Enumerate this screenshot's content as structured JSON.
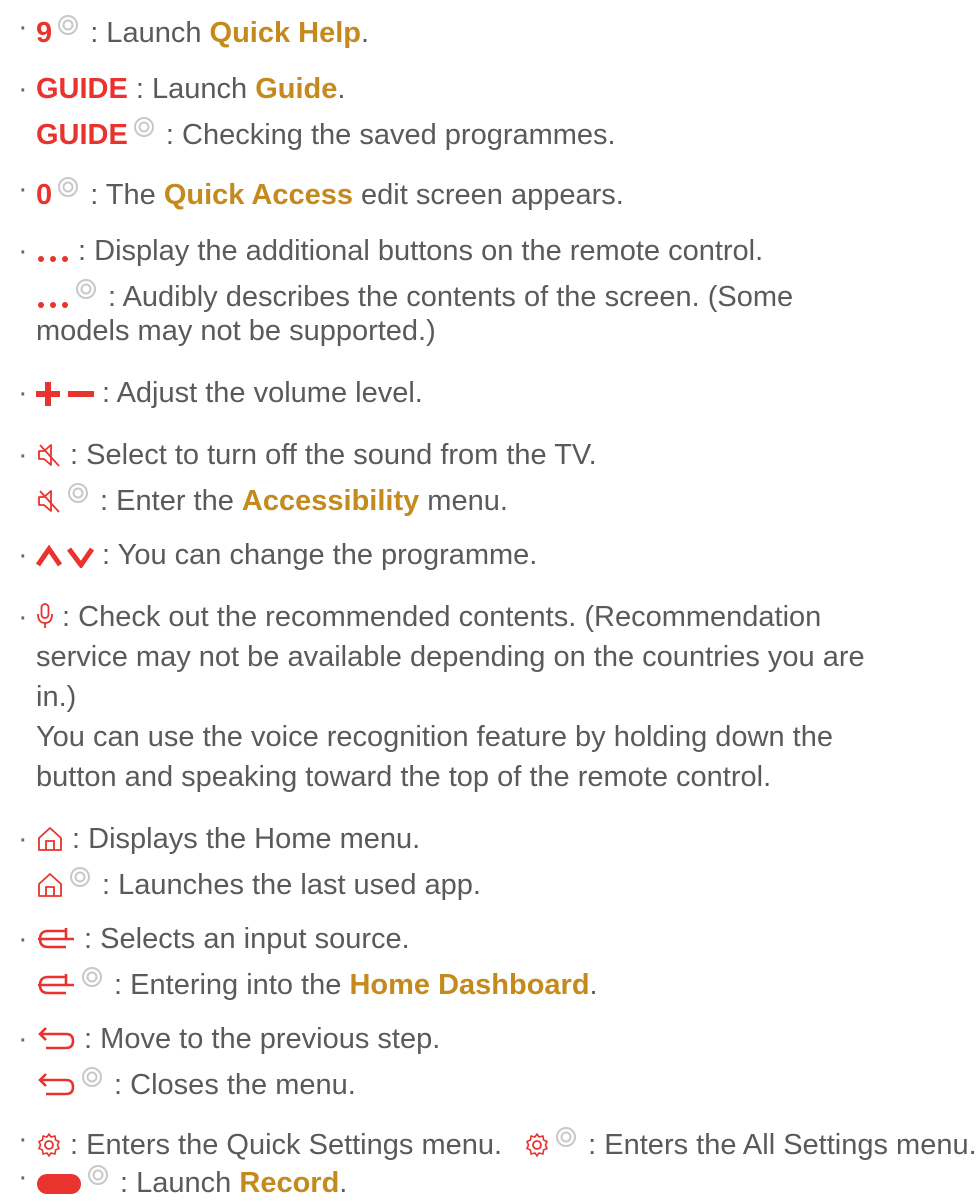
{
  "colors": {
    "text": "#5a5a5a",
    "key_red": "#e8332e",
    "menu_gold": "#c48a1d",
    "hold_icon": "#c8c8c8"
  },
  "bullet": "·",
  "items": [
    {
      "key": "9",
      "a1": " : Launch ",
      "m1": "Quick Help",
      "a2": "."
    },
    {
      "key": "GUIDE",
      "a1": " : Launch ",
      "m1": "Guide",
      "a2": ".",
      "key2": "GUIDE",
      "b1": " : Checking the saved programmes."
    },
    {
      "key": "0",
      "a1": " : The ",
      "m1": "Quick Access",
      "a2": " edit screen appears."
    },
    {
      "icon": "more-dots-icon",
      "a1": " : Display the additional buttons on the remote control.",
      "b1": " : Audibly describes the contents of the screen. (Some",
      "b2": "models may not be supported.)"
    },
    {
      "icon": "volume-plus-minus-icon",
      "a1": " : Adjust the volume level."
    },
    {
      "icon": "mute-icon",
      "a1": " : Select to turn off the sound from the TV.",
      "b1": " : Enter the ",
      "m2": "Accessibility",
      "b2": " menu."
    },
    {
      "icon": "channel-up-down-icon",
      "a1": " : You can change the programme."
    },
    {
      "icon": "microphone-icon",
      "a1": " : Check out the recommended contents. (Recommendation",
      "a2": "service may not be available depending on the countries you are",
      "a3": "in.)",
      "a4": "You can use the voice recognition feature by holding down the",
      "a5": "button and speaking toward the top of the remote control."
    },
    {
      "icon": "home-icon",
      "a1": " : Displays the Home menu.",
      "b1": " : Launches the last used app."
    },
    {
      "icon": "input-source-icon",
      "a1": " : Selects an input source.",
      "b1": " : Entering into the ",
      "m2": "Home Dashboard",
      "b2": "."
    },
    {
      "icon": "back-arrow-icon",
      "a1": " : Move to the previous step.",
      "b1": " : Closes the menu."
    },
    {
      "icon": "settings-gear-icon",
      "a1": " : Enters the Quick Settings menu.",
      "b1": " : Enters the All Settings menu."
    },
    {
      "icon": "record-icon",
      "a1": " : Launch ",
      "m1": "Record",
      "a2": "."
    }
  ]
}
